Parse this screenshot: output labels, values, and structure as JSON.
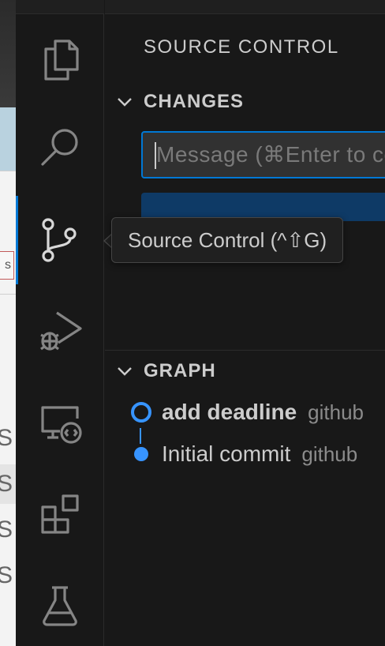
{
  "activity_bar": {
    "items": [
      {
        "icon": "files-icon",
        "name": "Explorer"
      },
      {
        "icon": "search-icon",
        "name": "Search"
      },
      {
        "icon": "source-control-icon",
        "name": "Source Control",
        "active": true
      },
      {
        "icon": "run-debug-icon",
        "name": "Run and Debug"
      },
      {
        "icon": "remote-explorer-icon",
        "name": "Remote Explorer"
      },
      {
        "icon": "extensions-icon",
        "name": "Extensions"
      },
      {
        "icon": "testing-icon",
        "name": "Testing"
      }
    ]
  },
  "tooltip": {
    "text": "Source Control (^⇧G)"
  },
  "side_panel": {
    "title": "SOURCE CONTROL",
    "changes": {
      "header": "CHANGES",
      "message_placeholder": "Message (⌘Enter to commit on \"main\")",
      "message_value": ""
    },
    "graph": {
      "header": "GRAPH",
      "commits": [
        {
          "message": "add deadline",
          "author": "github",
          "current": true
        },
        {
          "message": "Initial commit",
          "author": "github",
          "current": false
        }
      ]
    }
  },
  "colors": {
    "accent": "#0078d4",
    "graph_node": "#3794ff",
    "panel_bg": "#181818",
    "tooltip_bg": "#202020"
  }
}
